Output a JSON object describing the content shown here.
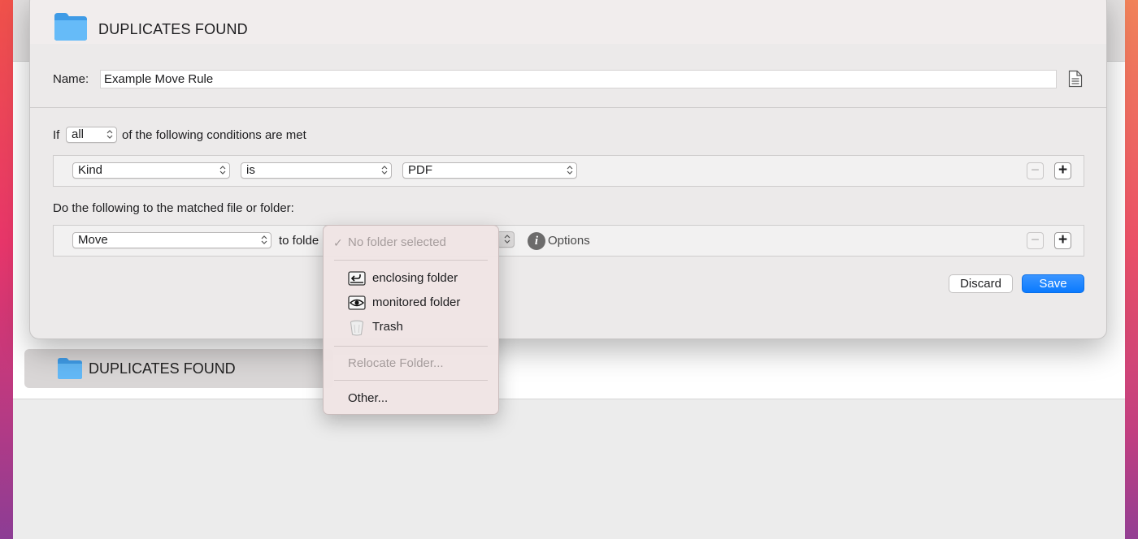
{
  "sheet": {
    "title": "DUPLICATES FOUND",
    "name_label": "Name:",
    "name_value": "Example Move Rule"
  },
  "conditions": {
    "if_label": "If",
    "match_mode": "all",
    "rest_label": "of the following conditions are met",
    "rule": {
      "attribute": "Kind",
      "operator": "is",
      "value": "PDF"
    }
  },
  "actions": {
    "label": "Do the following to the matched file or folder:",
    "action": "Move",
    "to_folder_label": "to folde",
    "options_label": "Options"
  },
  "buttons": {
    "discard": "Discard",
    "save": "Save",
    "remove": "−",
    "add": "+"
  },
  "menu": {
    "checkmark": "✓",
    "no_folder": "No folder selected",
    "enclosing": "enclosing folder",
    "monitored": "monitored folder",
    "trash": "Trash",
    "relocate": "Relocate Folder...",
    "other": "Other..."
  },
  "background": {
    "selected_row": "DUPLICATES FOUND"
  },
  "colors": {
    "accent": "#0a7aff",
    "folder": "#5bb4f5"
  },
  "icons": {
    "folder": "folder-icon",
    "document": "document-icon",
    "info": "info-icon",
    "enclosing": "enclosing-folder-icon",
    "monitored": "eye-icon",
    "trash": "trash-icon"
  }
}
